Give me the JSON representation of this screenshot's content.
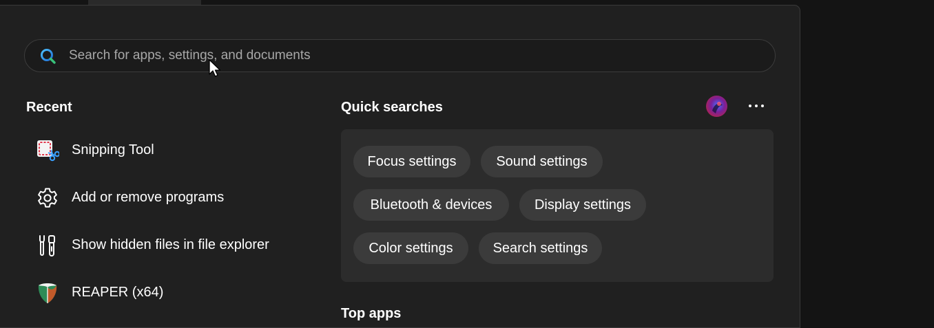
{
  "search": {
    "placeholder": "Search for apps, settings, and documents"
  },
  "recent": {
    "title": "Recent",
    "items": [
      {
        "label": "Snipping Tool",
        "icon": "snipping-tool-icon"
      },
      {
        "label": "Add or remove programs",
        "icon": "gear-icon"
      },
      {
        "label": "Show hidden files in file explorer",
        "icon": "tools-icon"
      },
      {
        "label": "REAPER (x64)",
        "icon": "reaper-icon"
      }
    ]
  },
  "quick_searches": {
    "title": "Quick searches",
    "chips": [
      {
        "label": "Focus settings"
      },
      {
        "label": "Sound settings"
      },
      {
        "label": "Bluetooth & devices"
      },
      {
        "label": "Display settings"
      },
      {
        "label": "Color settings"
      },
      {
        "label": "Search settings"
      }
    ]
  },
  "top_apps": {
    "title": "Top apps"
  },
  "header_actions": {
    "avatar_icon": "user-avatar",
    "more_icon": "more-options-icon"
  },
  "colors": {
    "panel_background": "#202020",
    "chip_background": "#3b3b3b",
    "accent": "#0078d4"
  }
}
